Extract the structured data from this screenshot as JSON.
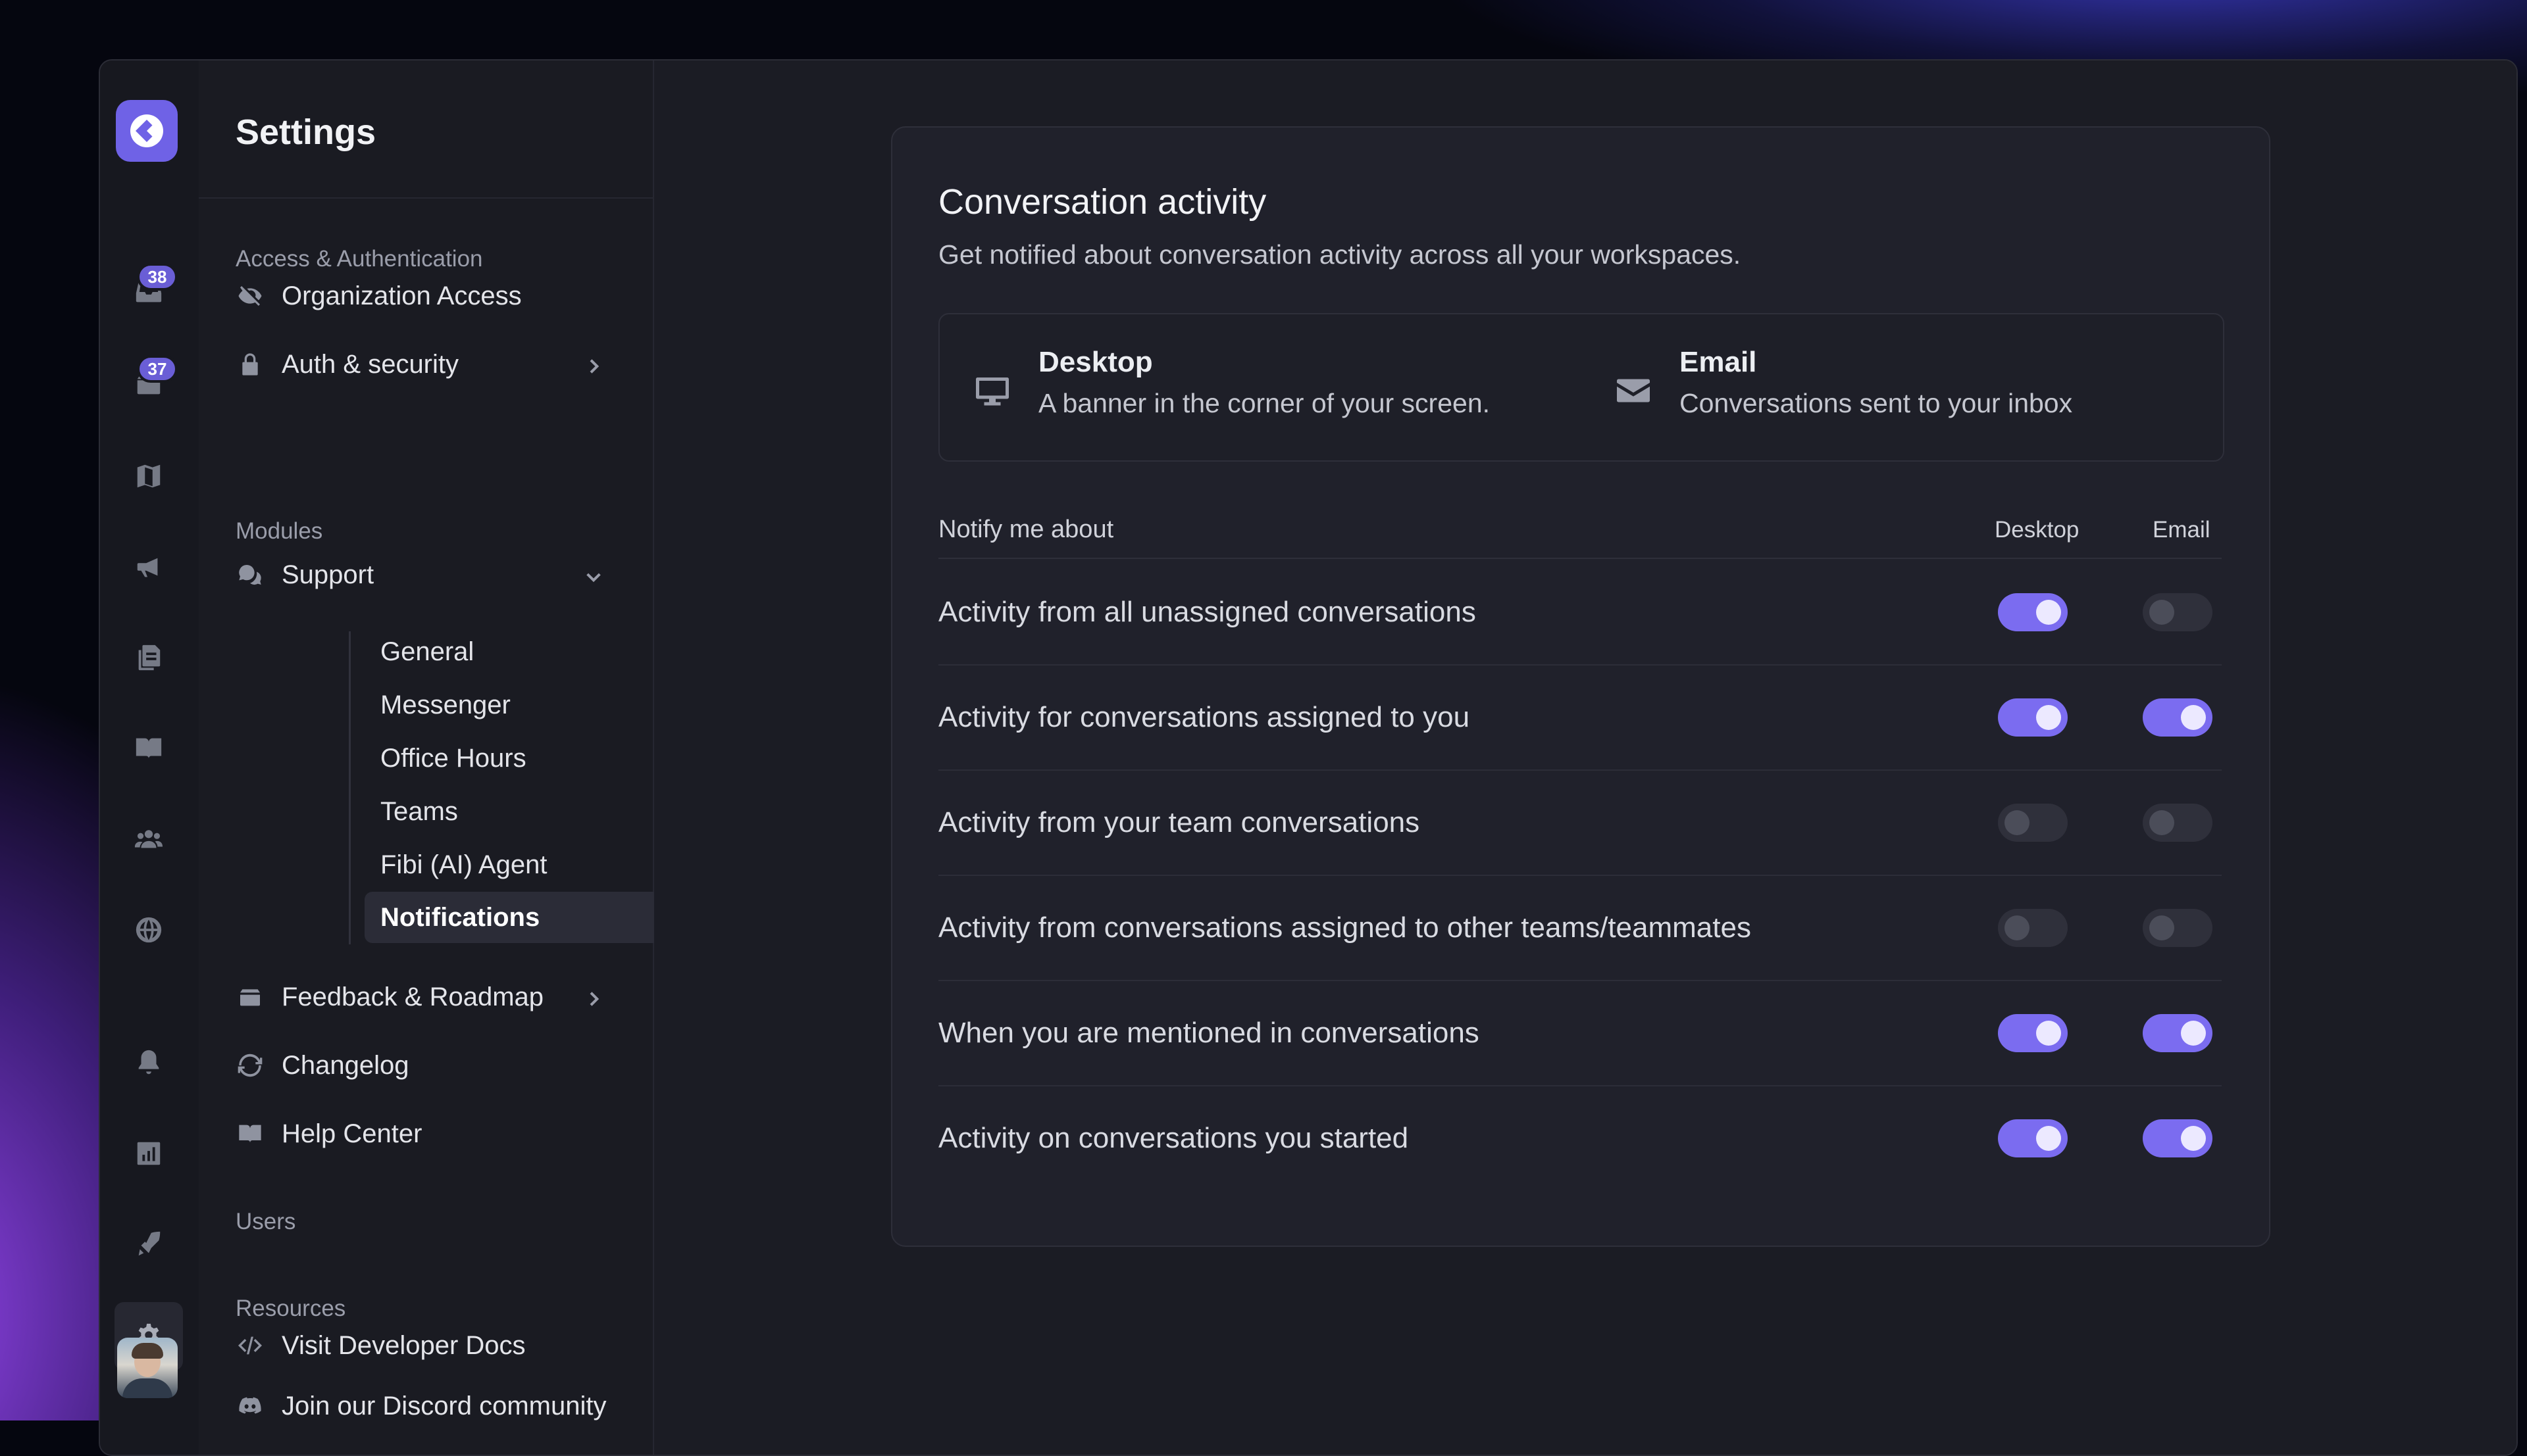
{
  "rail": {
    "inbox_badge": "38",
    "tickets_badge": "37"
  },
  "sidebar": {
    "title": "Settings",
    "sections": {
      "access": "Access & Authentication",
      "modules": "Modules",
      "users": "Users",
      "resources": "Resources"
    },
    "items": {
      "organization_access": "Organization Access",
      "auth_security": "Auth & security",
      "support": "Support",
      "feedback_roadmap": "Feedback & Roadmap",
      "changelog": "Changelog",
      "help_center": "Help Center",
      "developer_docs": "Visit Developer Docs",
      "discord": "Join our Discord community"
    },
    "support_sub": {
      "general": "General",
      "messenger": "Messenger",
      "office_hours": "Office Hours",
      "teams": "Teams",
      "fibi": "Fibi (AI) Agent",
      "notifications": "Notifications"
    }
  },
  "main": {
    "title": "Conversation activity",
    "description": "Get notified about conversation activity across all your workspaces.",
    "channels": {
      "desktop": {
        "name": "Desktop",
        "description": "A banner in the corner of your screen."
      },
      "email": {
        "name": "Email",
        "description": "Conversations sent to your inbox"
      }
    },
    "table": {
      "header_label": "Notify me about",
      "col_desktop": "Desktop",
      "col_email": "Email"
    },
    "rows": [
      {
        "label": "Activity from all unassigned conversations",
        "desktop": true,
        "email": false
      },
      {
        "label": "Activity for conversations assigned to you",
        "desktop": true,
        "email": true
      },
      {
        "label": "Activity from your team conversations",
        "desktop": false,
        "email": false
      },
      {
        "label": "Activity from conversations assigned to other teams/teammates",
        "desktop": false,
        "email": false
      },
      {
        "label": "When you are mentioned in conversations",
        "desktop": true,
        "email": true
      },
      {
        "label": "Activity on conversations you started",
        "desktop": true,
        "email": true
      }
    ]
  },
  "colors": {
    "accent": "#7b6cf0",
    "badge": "#6a5ed6",
    "toggle_off": "#2f303b"
  }
}
